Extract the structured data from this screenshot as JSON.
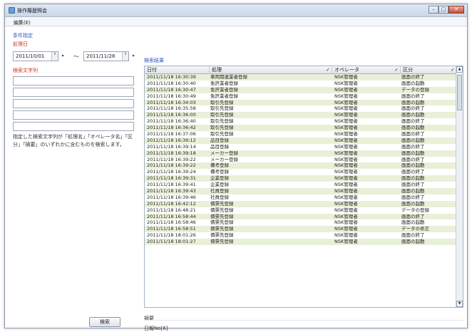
{
  "window": {
    "title": "操作履歴照会",
    "controls": [
      "–",
      "□",
      "✕"
    ]
  },
  "menu": {
    "edit": "編集(E)"
  },
  "conditions": {
    "section_title": "条件指定",
    "date_label": "処理日",
    "date_from": "2011/10/01",
    "date_to": "2011/11/28",
    "range_sep": "～",
    "keyword_label": "検索文字列",
    "keywords": [
      "",
      "",
      "",
      "",
      ""
    ],
    "description": "指定した検索文字列が「処理名」「オペレータ名」「区分」「摘要」のいずれかに含むものを検索します。",
    "search_button": "検索"
  },
  "results": {
    "section_title": "検索結果",
    "headers": {
      "date": "日付",
      "process": "処理",
      "operator": "オペレータ",
      "kind": "区分"
    },
    "rows": [
      [
        "2011/11/18 16:30:39",
        "車両関連業者登録",
        "NSK管理者",
        "画面の終了"
      ],
      [
        "2011/11/18 16:30:40",
        "免許業者登録",
        "NSK管理者",
        "画面の起動"
      ],
      [
        "2011/11/18 16:30:47",
        "免許業者登録",
        "NSK管理者",
        "データの登録"
      ],
      [
        "2011/11/18 16:30:49",
        "免許業者登録",
        "NSK管理者",
        "画面の終了"
      ],
      [
        "2011/11/18 16:34:03",
        "取引先登録",
        "NSK管理者",
        "画面の起動"
      ],
      [
        "2011/11/18 16:35:58",
        "取引先登録",
        "NSK管理者",
        "画面の終了"
      ],
      [
        "2011/11/18 16:36:00",
        "取引先登録",
        "NSK管理者",
        "画面の起動"
      ],
      [
        "2011/11/18 16:36:40",
        "取引先登録",
        "NSK管理者",
        "画面の終了"
      ],
      [
        "2011/11/18 16:36:42",
        "取引先登録",
        "NSK管理者",
        "画面の起動"
      ],
      [
        "2011/11/18 16:37:06",
        "取引先登録",
        "NSK管理者",
        "画面の終了"
      ],
      [
        "2011/11/18 16:39:12",
        "品目登録",
        "NSK管理者",
        "画面の起動"
      ],
      [
        "2011/11/18 16:39:14",
        "品目登録",
        "NSK管理者",
        "画面の終了"
      ],
      [
        "2011/11/18 16:39:18",
        "メーカー登録",
        "NSK管理者",
        "画面の起動"
      ],
      [
        "2011/11/18 16:39:22",
        "メーカー登録",
        "NSK管理者",
        "画面の終了"
      ],
      [
        "2011/11/18 16:39:22",
        "備考登録",
        "NSK管理者",
        "画面の起動"
      ],
      [
        "2011/11/18 16:39:24",
        "備考登録",
        "NSK管理者",
        "画面の終了"
      ],
      [
        "2011/11/18 16:39:31",
        "企業登録",
        "NSK管理者",
        "画面の起動"
      ],
      [
        "2011/11/18 16:39:41",
        "企業登録",
        "NSK管理者",
        "画面の終了"
      ],
      [
        "2011/11/18 16:39:43",
        "社員登録",
        "NSK管理者",
        "画面の起動"
      ],
      [
        "2011/11/18 16:39:46",
        "社員登録",
        "NSK管理者",
        "画面の終了"
      ],
      [
        "2011/11/18 16:42:12",
        "債票先登録",
        "NSK管理者",
        "画面の起動"
      ],
      [
        "2011/11/18 16:48:21",
        "債票先登録",
        "NSK管理者",
        "データの登録"
      ],
      [
        "2011/11/18 16:58:44",
        "債票先登録",
        "NSK管理者",
        "画面の終了"
      ],
      [
        "2011/11/18 16:58:46",
        "債票先登録",
        "NSK管理者",
        "画面の起動"
      ],
      [
        "2011/11/18 16:58:51",
        "債票先登録",
        "NSK管理者",
        "データの修正"
      ],
      [
        "2011/11/18 18:01:26",
        "債票先登録",
        "NSK管理者",
        "画面の終了"
      ],
      [
        "2011/11/18 18:01:27",
        "債票先登録",
        "NSK管理者",
        "画面の起動"
      ]
    ]
  },
  "summary": {
    "label": "摘要",
    "value": "日報No[6]"
  },
  "colors": {
    "accent": "#2b57c7",
    "required": "#d0342c",
    "row_alt": "#e8f0d8"
  },
  "icons": {
    "filter": "✓",
    "scroll_up": "▲",
    "scroll_down": "▼",
    "spin": "⇕",
    "dropdown": "▾"
  }
}
